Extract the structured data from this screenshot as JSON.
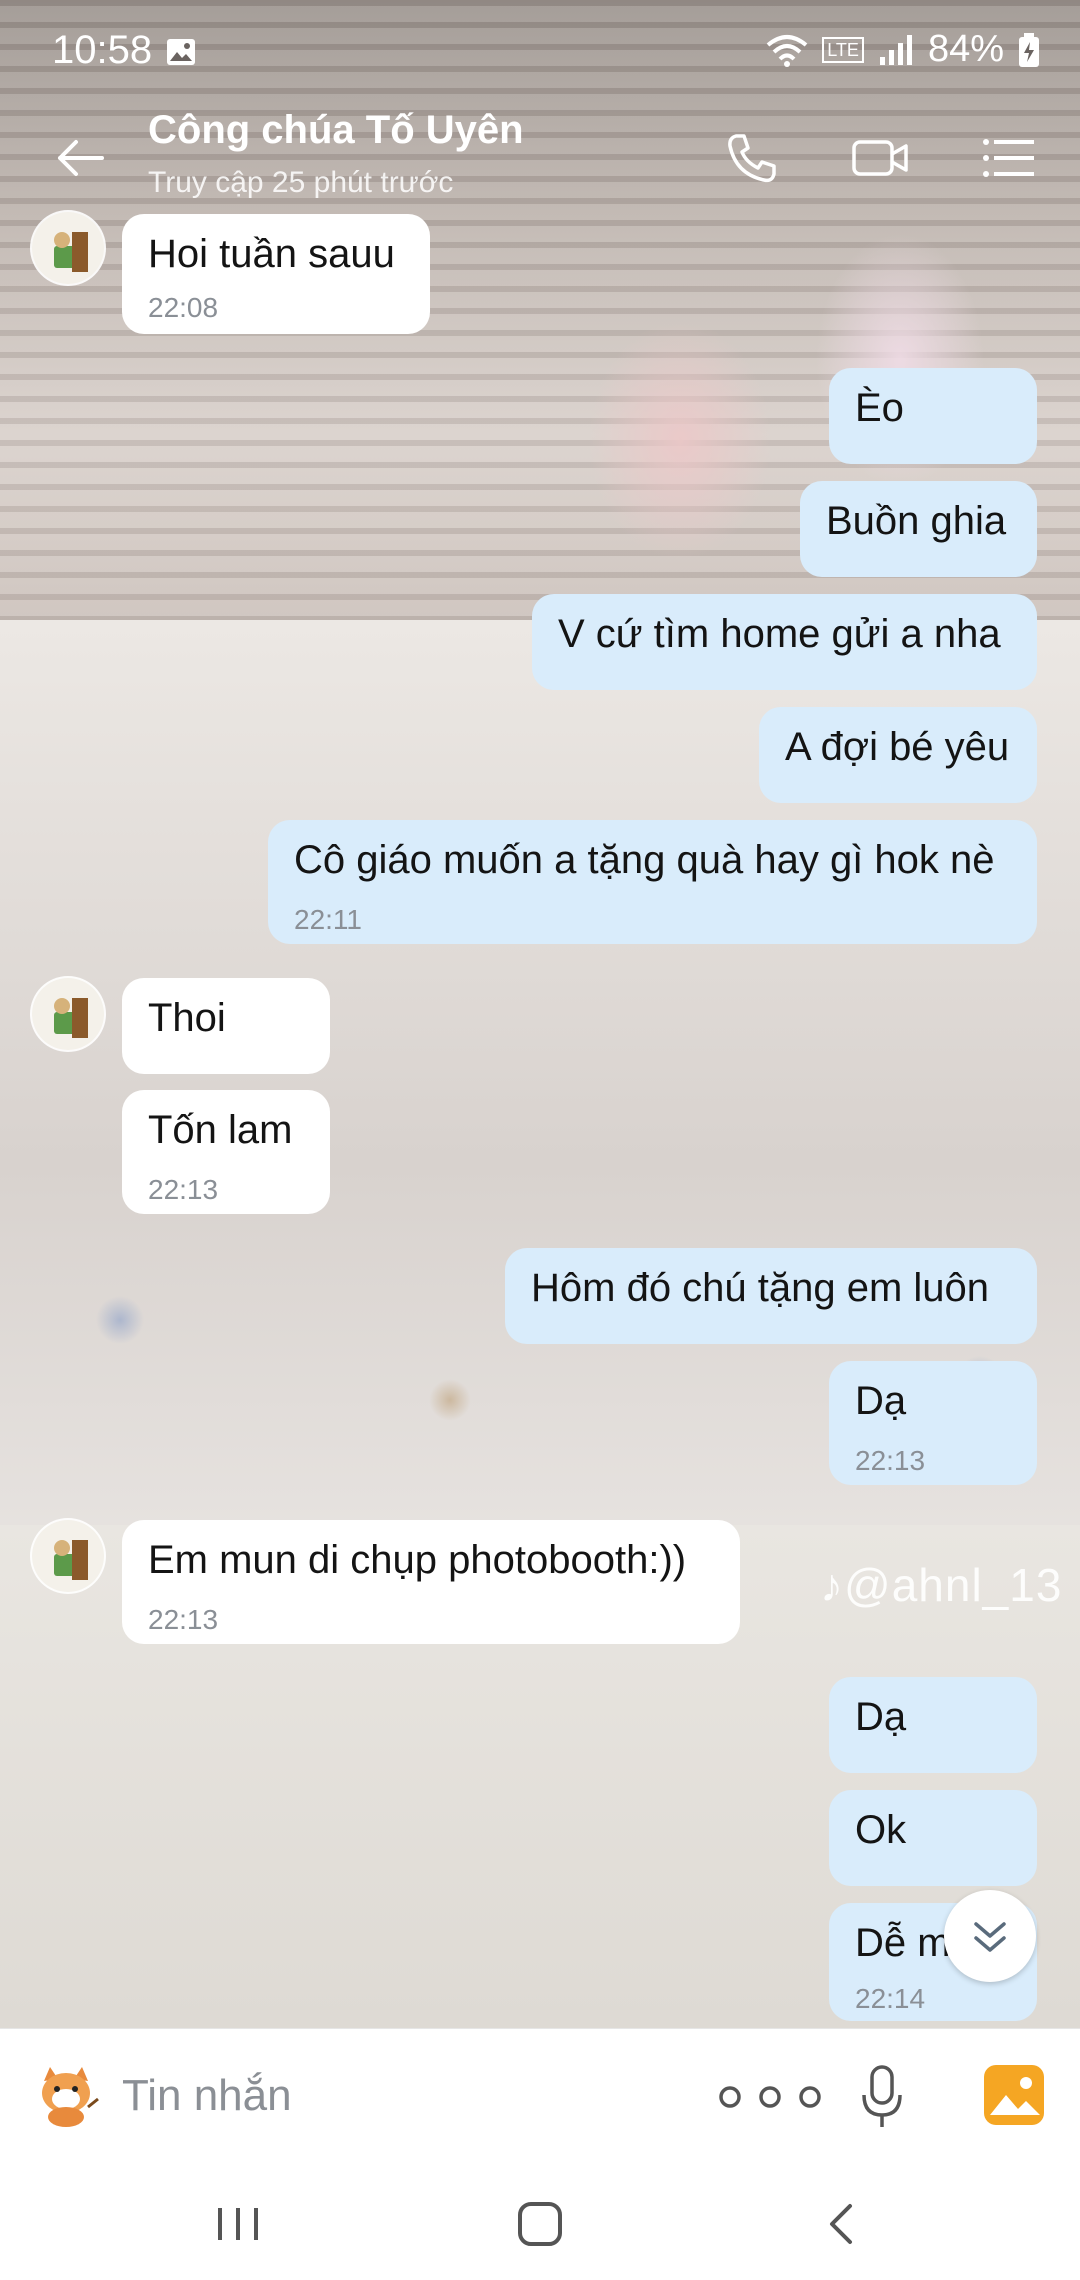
{
  "status_bar": {
    "time": "10:58",
    "battery": "84%",
    "network_label": "LTE"
  },
  "header": {
    "title": "Công chúa Tố Uyên",
    "subtitle": "Truy cập 25 phút trước"
  },
  "watermark": "♪@ahnl_13",
  "messages": [
    {
      "side": "in",
      "text": "Hoi tuần sauu",
      "time": "22:08"
    },
    {
      "side": "out",
      "text": "Èo",
      "time": ""
    },
    {
      "side": "out",
      "text": "Buồn ghia",
      "time": ""
    },
    {
      "side": "out",
      "text": "V cứ tìm home gửi a nha",
      "time": ""
    },
    {
      "side": "out",
      "text": "A đợi bé yêu",
      "time": ""
    },
    {
      "side": "out",
      "text": "Cô giáo muốn a tặng quà hay gì hok nè",
      "time": "22:11"
    },
    {
      "side": "in",
      "text": "Thoi",
      "time": ""
    },
    {
      "side": "in",
      "text": "Tốn lam",
      "time": "22:13"
    },
    {
      "side": "out",
      "text": "Hôm đó chú tặng em luôn",
      "time": ""
    },
    {
      "side": "out",
      "text": "Dạ",
      "time": "22:13"
    },
    {
      "side": "in",
      "text": "Em mun di chụp photobooth:))",
      "time": "22:13"
    },
    {
      "side": "out",
      "text": "Dạ",
      "time": ""
    },
    {
      "side": "out",
      "text": "Ok",
      "time": ""
    },
    {
      "side": "out",
      "text": "Dễ m",
      "time": "22:14"
    }
  ],
  "input": {
    "placeholder": "Tin nhắn"
  },
  "colors": {
    "outgoing_bubble": "#d9ecfb",
    "incoming_bubble": "#ffffff",
    "accent_image_button": "#f5a623"
  },
  "icons": [
    "back-arrow-icon",
    "phone-icon",
    "video-call-icon",
    "menu-list-icon",
    "sticker-icon",
    "more-icon",
    "microphone-icon",
    "image-icon",
    "scroll-down-icon"
  ]
}
